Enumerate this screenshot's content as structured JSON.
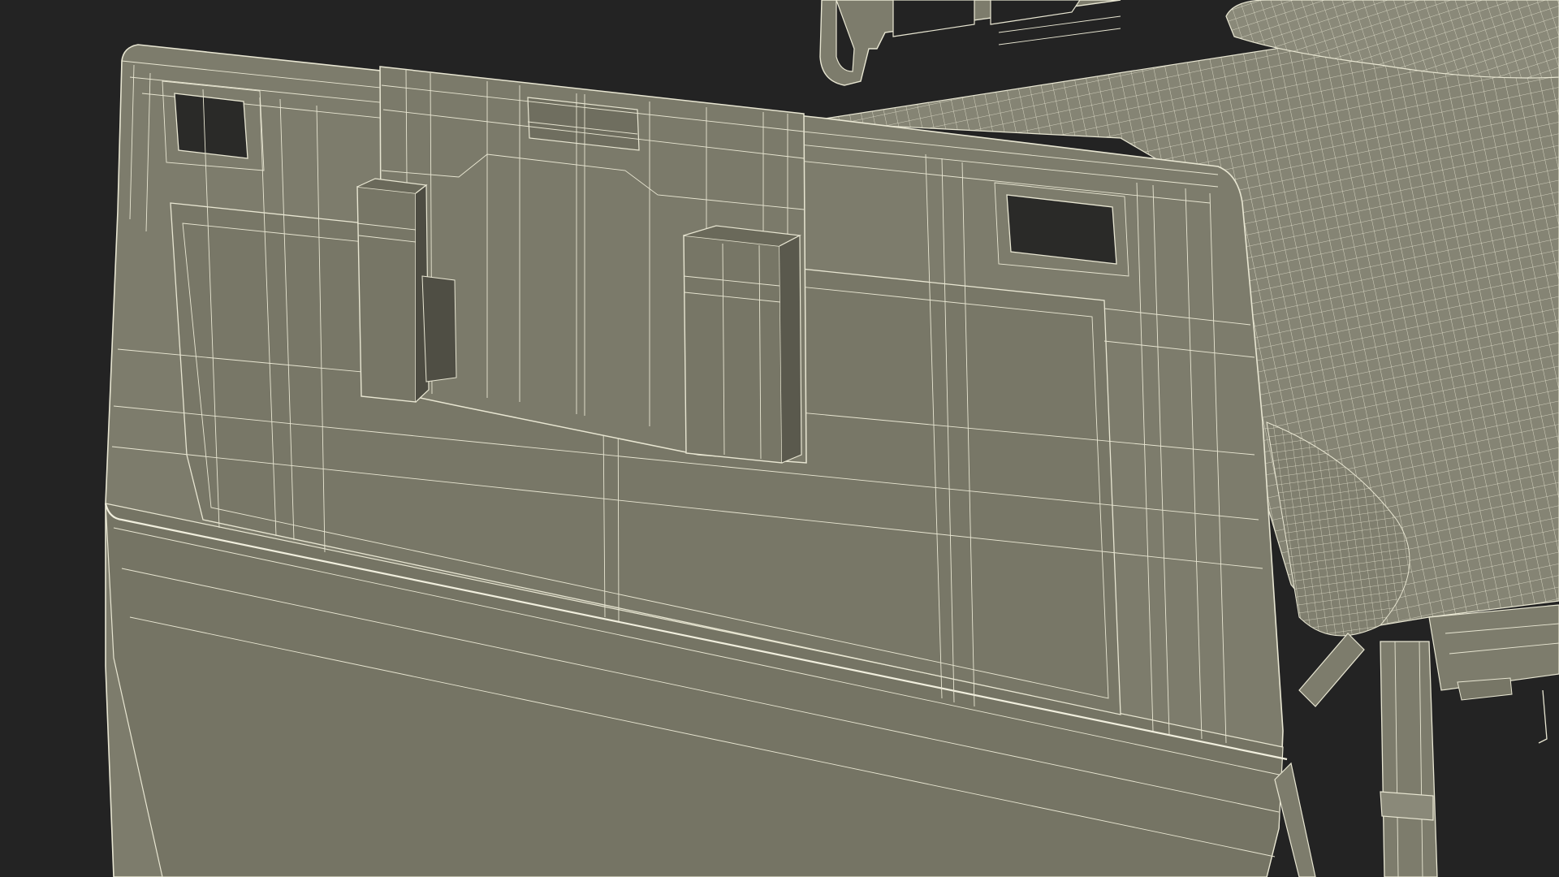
{
  "scene": {
    "subject": "hospital-bed-wireframe-render",
    "colors": {
      "background": "#232323",
      "surface": "#7d7c6c",
      "surface_dark": "#6c6b5c",
      "surface_light": "#8a8979",
      "wire": "#e8e6d2",
      "hole": "#2a2a28"
    }
  }
}
